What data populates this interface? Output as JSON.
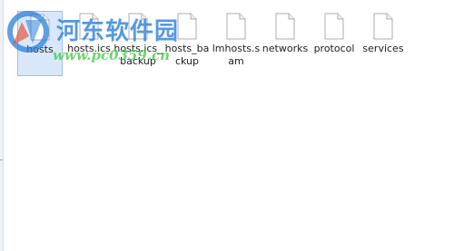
{
  "files": [
    {
      "name": "hosts",
      "selected": true
    },
    {
      "name": "hosts.ics",
      "selected": false
    },
    {
      "name": "hosts.ics_backup",
      "selected": false
    },
    {
      "name": "hosts_backup",
      "selected": false
    },
    {
      "name": "lmhosts.sam",
      "selected": false
    },
    {
      "name": "networks",
      "selected": false
    },
    {
      "name": "protocol",
      "selected": false
    },
    {
      "name": "services",
      "selected": false
    }
  ],
  "icons": {
    "file": "document-icon",
    "watermark_logo": "site-logo"
  },
  "watermark": {
    "title": "河东软件园",
    "url": "www.pc0359.cn"
  },
  "colors": {
    "selection_bg": "#d8e8fa",
    "selection_border": "#99c1ee",
    "watermark_blue": "#2980dc",
    "watermark_green": "#3cc83c"
  }
}
